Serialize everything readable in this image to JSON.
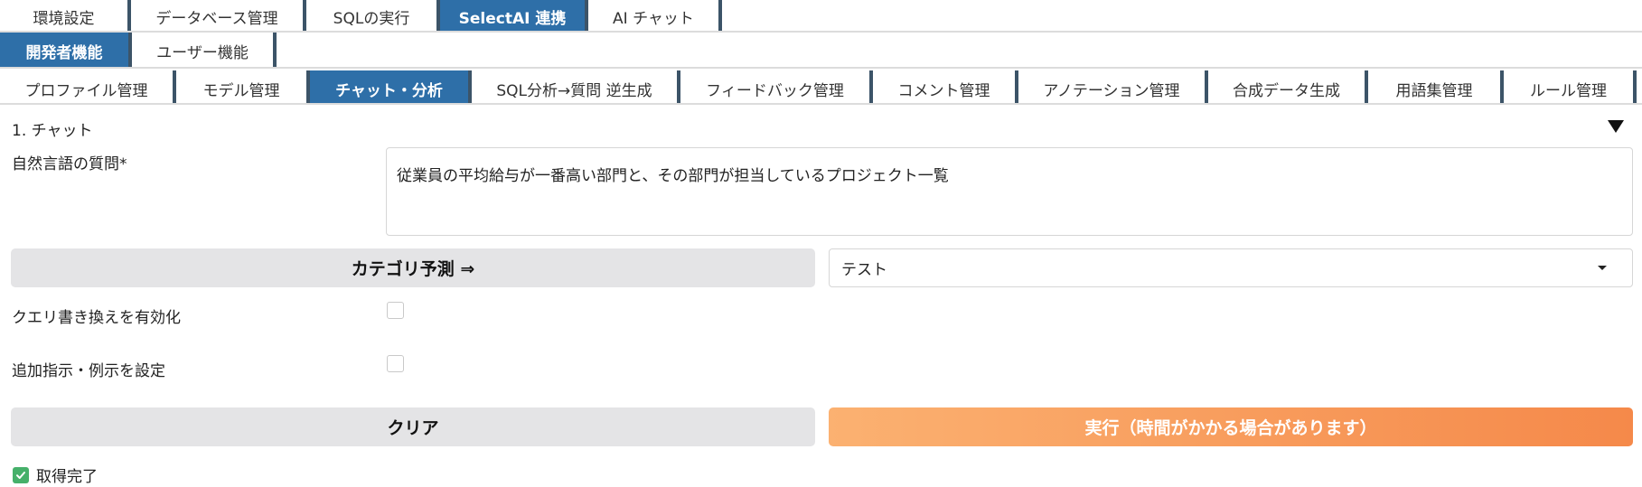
{
  "tabs_main": [
    "環境設定",
    "データベース管理",
    "SQLの実行",
    "SelectAI 連携",
    "AI チャット"
  ],
  "tabs_main_active": "SelectAI 連携",
  "tabs_role": [
    "開発者機能",
    "ユーザー機能"
  ],
  "tabs_role_active": "開発者機能",
  "tabs_dev": [
    "プロファイル管理",
    "モデル管理",
    "チャット・分析",
    "SQL分析→質問 逆生成",
    "フィードバック管理",
    "コメント管理",
    "アノテーション管理",
    "合成データ生成",
    "用語集管理",
    "ルール管理"
  ],
  "tabs_dev_active": "チャット・分析",
  "section": {
    "title": "1. チャット"
  },
  "question": {
    "label": "自然言語の質問*",
    "value": "従業員の平均給与が一番高い部門と、その部門が担当しているプロジェクト一覧"
  },
  "category": {
    "button_label": "カテゴリ予測 ⇒",
    "selected": "テスト"
  },
  "options": {
    "query_rewrite_label": "クエリ書き換えを有効化",
    "query_rewrite_checked": false,
    "extra_instructions_label": "追加指示・例示を設定",
    "extra_instructions_checked": false
  },
  "actions": {
    "clear_label": "クリア",
    "run_label": "実行（時間がかかる場合があります）"
  },
  "status": {
    "text": "取得完了"
  },
  "colors": {
    "tab_active": "#2e6fa8",
    "run_button_start": "#fbb171",
    "run_button_end": "#f5894a",
    "status_check": "#46b06a"
  }
}
